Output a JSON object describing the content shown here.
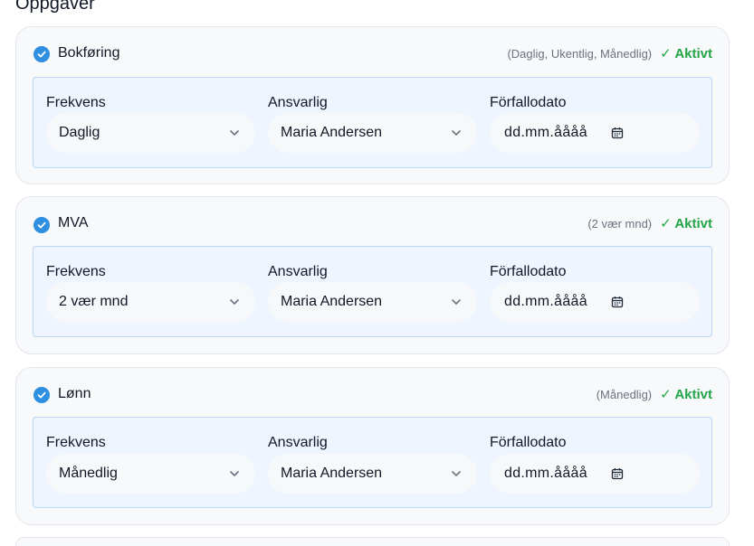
{
  "section": {
    "title": "Oppgaver"
  },
  "labels": {
    "frequency": "Frekvens",
    "responsible": "Ansvarlig",
    "due_date": "Förfallodato"
  },
  "tasks": [
    {
      "name": "Bokføring",
      "frequency_summary": "(Daglig, Ukentlig, Månedlig)",
      "status": "✓ Aktivt",
      "frequency_value": "Daglig",
      "responsible_value": "Maria Andersen",
      "due_date_placeholder": "dd.mm.åååå"
    },
    {
      "name": "MVA",
      "frequency_summary": "(2 vær mnd)",
      "status": "✓ Aktivt",
      "frequency_value": "2 vær mnd",
      "responsible_value": "Maria Andersen",
      "due_date_placeholder": "dd.mm.åååå"
    },
    {
      "name": "Lønn",
      "frequency_summary": "(Månedlig)",
      "status": "✓ Aktivt",
      "frequency_value": "Månedlig",
      "responsible_value": "Maria Andersen",
      "due_date_placeholder": "dd.mm.åååå"
    }
  ],
  "icons": {
    "checkbox": "check-circle-icon",
    "dropdown": "chevron-down-icon",
    "date": "calendar-icon"
  },
  "colors": {
    "accent": "#2f8fe0",
    "status_active": "#22a447",
    "panel_bg": "#eef5ff",
    "panel_border": "#b9d6f2"
  }
}
